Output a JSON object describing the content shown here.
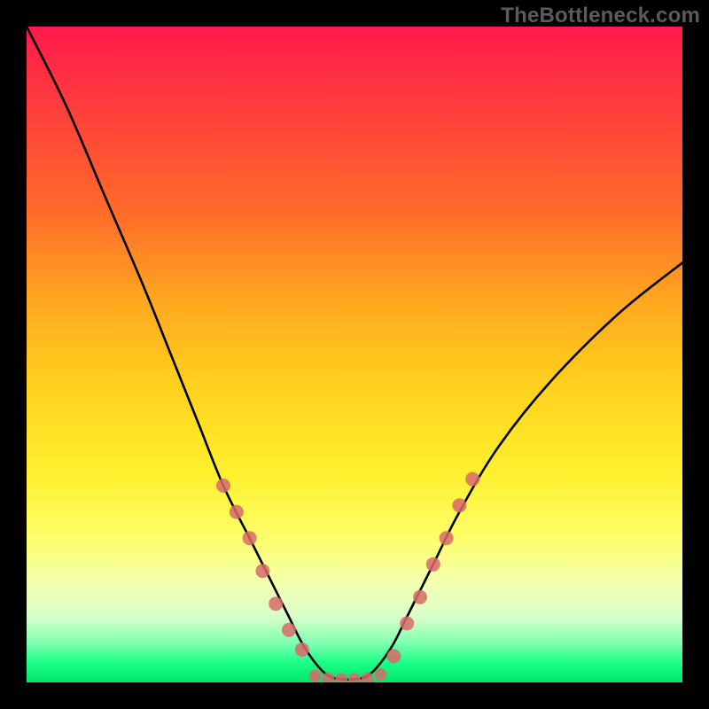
{
  "watermark": "TheBottleneck.com",
  "colors": {
    "curve_stroke": "#000000",
    "dot_fill": "#d86a6a",
    "background_black": "#000000"
  },
  "chart_data": {
    "type": "line",
    "title": "",
    "xlabel": "",
    "ylabel": "",
    "xlim": [
      0,
      100
    ],
    "ylim": [
      0,
      100
    ],
    "grid": false,
    "series": [
      {
        "name": "bottleneck-curve",
        "x": [
          0,
          6,
          12,
          18,
          22,
          26,
          30,
          34,
          36,
          38,
          40,
          42,
          44,
          46,
          48,
          50,
          52,
          54,
          56,
          58,
          62,
          66,
          72,
          80,
          90,
          100
        ],
        "y": [
          100,
          88,
          74,
          60,
          50,
          40,
          30,
          22,
          18,
          14,
          10,
          6,
          3,
          1,
          0.5,
          0.5,
          1,
          3,
          6,
          10,
          18,
          26,
          36,
          46,
          56,
          64
        ]
      }
    ],
    "dots_left": [
      [
        30,
        30
      ],
      [
        32,
        26
      ],
      [
        34,
        22
      ],
      [
        36,
        17
      ],
      [
        38,
        12
      ],
      [
        40,
        8
      ],
      [
        42,
        5
      ]
    ],
    "dots_right": [
      [
        56,
        4
      ],
      [
        58,
        9
      ],
      [
        60,
        13
      ],
      [
        62,
        18
      ],
      [
        64,
        22
      ],
      [
        66,
        27
      ],
      [
        68,
        31
      ]
    ],
    "dots_bottom": [
      [
        44,
        1
      ],
      [
        46,
        0.6
      ],
      [
        48,
        0.5
      ],
      [
        50,
        0.5
      ],
      [
        52,
        0.6
      ],
      [
        54,
        1.2
      ]
    ],
    "gradient_stops": [
      {
        "pct": 0,
        "color": "#ff1a4b"
      },
      {
        "pct": 12,
        "color": "#ff3d3d"
      },
      {
        "pct": 28,
        "color": "#ff6a2a"
      },
      {
        "pct": 42,
        "color": "#ffa81f"
      },
      {
        "pct": 55,
        "color": "#ffd21e"
      },
      {
        "pct": 68,
        "color": "#fff02e"
      },
      {
        "pct": 78,
        "color": "#fdff6a"
      },
      {
        "pct": 85,
        "color": "#f3ffb0"
      },
      {
        "pct": 90,
        "color": "#d8ffca"
      },
      {
        "pct": 94,
        "color": "#7fffb0"
      },
      {
        "pct": 97,
        "color": "#1bff86"
      },
      {
        "pct": 100,
        "color": "#00e46c"
      }
    ]
  }
}
